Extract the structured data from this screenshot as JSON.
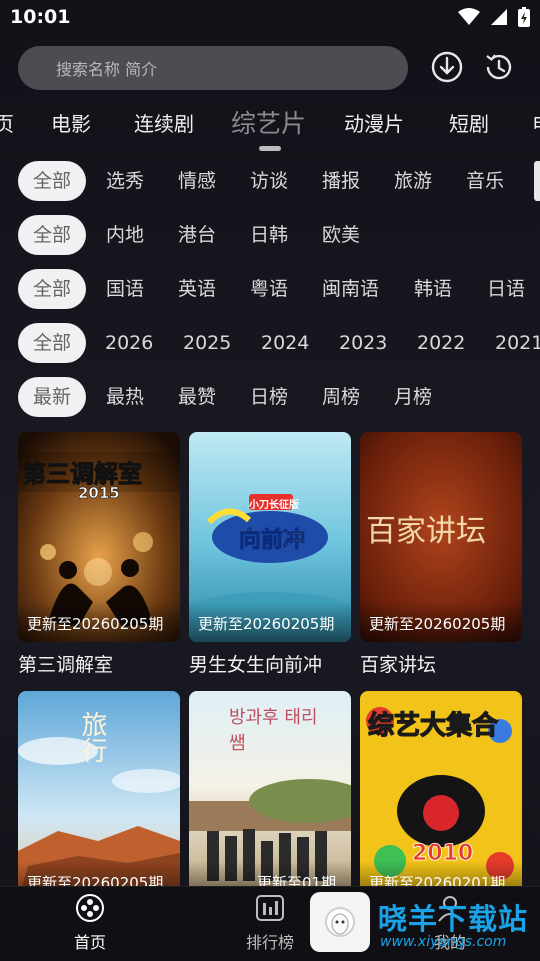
{
  "status": {
    "time": "10:01"
  },
  "search": {
    "placeholder": "搜索名称 简介"
  },
  "header_icons": {
    "download": "download-icon",
    "history": "history-icon"
  },
  "category_tabs": [
    {
      "label": "页"
    },
    {
      "label": "电影"
    },
    {
      "label": "连续剧"
    },
    {
      "label": "综艺片",
      "active": true
    },
    {
      "label": "动漫片"
    },
    {
      "label": "短剧"
    },
    {
      "label": "电"
    }
  ],
  "filters": {
    "type": [
      "全部",
      "选秀",
      "情感",
      "访谈",
      "播报",
      "旅游",
      "音乐"
    ],
    "region": [
      "全部",
      "内地",
      "港台",
      "日韩",
      "欧美"
    ],
    "language": [
      "全部",
      "国语",
      "英语",
      "粤语",
      "闽南语",
      "韩语",
      "日语"
    ],
    "year": [
      "全部",
      "2026",
      "2025",
      "2024",
      "2023",
      "2022",
      "2021"
    ],
    "sort": [
      "最新",
      "最热",
      "最赞",
      "日榜",
      "周榜",
      "月榜"
    ]
  },
  "cards": [
    {
      "title": "第三调解室",
      "badge": "更新至20260205期",
      "poster_text": "第三调解室",
      "poster_sub": "2015"
    },
    {
      "title": "男生女生向前冲",
      "badge": "更新至20260205期",
      "poster_text": "向前冲",
      "poster_sub": "小刀长征版"
    },
    {
      "title": "百家讲坛",
      "badge": "更新至20260205期",
      "poster_text": "百家讲坛",
      "poster_sub": ""
    },
    {
      "title": "",
      "badge": "更新至20260205期",
      "poster_text": "旅行",
      "poster_sub": ""
    },
    {
      "title": "",
      "badge": "更新至01期",
      "poster_text": "방과후 태리쌤",
      "poster_sub": ""
    },
    {
      "title": "",
      "badge": "更新至20260201期",
      "poster_text": "综艺大集合",
      "poster_sub": "2010"
    }
  ],
  "bottom_nav": [
    {
      "label": "首页",
      "icon": "gamepad-icon",
      "active": true
    },
    {
      "label": "排行榜",
      "icon": "chart-icon"
    },
    {
      "label": "我的",
      "icon": "user-icon"
    }
  ],
  "watermark": {
    "title": "晓羊下载站",
    "url": "www.xiyangs.com"
  },
  "colors": {
    "background": "#15151c",
    "chip_selected": "#f1f1f3",
    "watermark": "#1aa3e8"
  }
}
